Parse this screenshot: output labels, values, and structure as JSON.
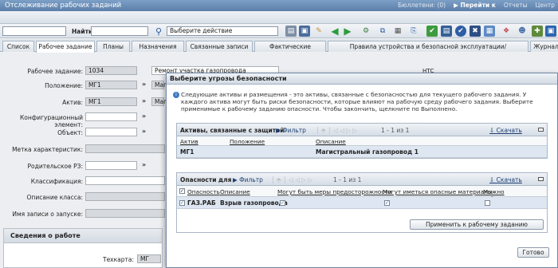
{
  "header": {
    "title": "Отслеживание рабочих заданий",
    "bulletins": "Бюллетени: (0)",
    "goto": "Перейти к",
    "reports": "Отчеты",
    "center": "Центр"
  },
  "toolbar": {
    "find_label": "Найти:",
    "action_select": "Выберите действие"
  },
  "tabs": [
    {
      "label": "Список"
    },
    {
      "label": "Рабочее задание"
    },
    {
      "label": "Планы"
    },
    {
      "label": "Назначения"
    },
    {
      "label": "Связанные записи"
    },
    {
      "label": "Фактические значения"
    },
    {
      "label": "Правила устройства и безопасной эксплуатации/производства работ"
    },
    {
      "label": "Журнал"
    }
  ],
  "form": {
    "work_order_label": "Рабочее задание:",
    "work_order_value": "1034",
    "work_order_desc": "Ремонт участка газопровода",
    "location_label": "Положение:",
    "location_value": "МГ1",
    "location_desc": "Маг",
    "asset_label": "Актив:",
    "asset_value": "МГ1",
    "asset_desc": "Маг",
    "config_label": "Конфигурационный элемент:",
    "object_label": "Объект:",
    "metric_label": "Метка характеристик:",
    "parent_label": "Родительское РЗ:",
    "class_label": "Классификация:",
    "class_desc_label": "Описание класса:",
    "launch_label": "Имя записи о запуске:",
    "section_title": "Сведения о работе",
    "techcard_label": "Техкарта:",
    "techcard_value": "МГ",
    "right_label": "НТС"
  },
  "dialog": {
    "title": "Выберите угрозы безопасности",
    "info": "Следующие активы и размещения - это активы, связанные с безопасностью для текущего рабочего задания. У каждого актива могут быть риски безопасности, которые влияют на рабочую среду рабочего задания. Выберите применимые к рабочему заданию опасности. Чтобы закончить, щелкните по Выполнено.",
    "assets_panel": {
      "title": "Активы, связанные с защитой",
      "filter": "Фильтр",
      "pager": "1 - 1 из 1",
      "download": "Скачать",
      "columns": [
        "Актив",
        "Положение",
        "Описание"
      ],
      "rows": [
        {
          "asset": "МГ1",
          "location": "",
          "description": "Магистральный газопровод 1"
        }
      ]
    },
    "hazards_panel": {
      "title": "Опасности для",
      "filter": "Фильтр",
      "pager": "1 - 1 из 1",
      "download": "Скачать",
      "columns": [
        "Опасность",
        "Описание",
        "Могут быть меры предосторожности",
        "Могут иметься опасные материалы",
        "Можно отбраковывать"
      ],
      "rows": [
        {
          "hazard": "ГАЗ.РАБ",
          "description": "Взрыв газопровода",
          "precautions": true,
          "materials": true,
          "tagout": false
        }
      ],
      "apply_button": "Применить к рабочему заданию"
    },
    "done_button": "Готово"
  }
}
